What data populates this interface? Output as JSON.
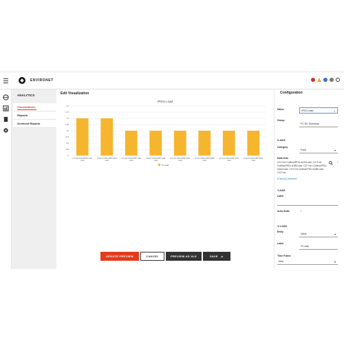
{
  "topbar": {
    "brand": "ENVIRONET"
  },
  "sidebar": {
    "title": "ANALYTICS",
    "items": [
      {
        "label": "Visualizations",
        "active": true
      },
      {
        "label": "Reports",
        "active": false
      },
      {
        "label": "Archived Reports",
        "active": false
      }
    ]
  },
  "main": {
    "title": "Edit Visualization",
    "actions": {
      "update": "UPDATE PREVIEW",
      "cancel": "CANCEL",
      "preview_xls": "PREVIEW AS XLS",
      "save": "SAVE"
    }
  },
  "chart_data": {
    "type": "bar",
    "title": "rPDU Load",
    "categories": [
      "CG Fort Collins/rPDU A1A/Load",
      "CG Fort Collins/rPDU A1B/Load",
      "CG Fort Collins/rPDU A2A/Load",
      "CG Fort Collins/rPDU A2B/Load",
      "CG Fort Collins/rPDU B1A/Load",
      "CG Fort Collins/rPDU B2B/Load",
      "CG Fort Collins/rPDU B2A/Load",
      "CG Fort Collins/rPDU B3A/Load"
    ],
    "series": [
      {
        "name": "% Load",
        "values": [
          1.5,
          1.5,
          1.0,
          1.0,
          1.0,
          1.0,
          1.0,
          1.0
        ]
      }
    ],
    "ylim": [
      0,
      2.0
    ],
    "yticks": [
      "2.0",
      "1.75",
      "1.5",
      "1.25",
      "1.0",
      "0.75",
      "0.5",
      "0.25",
      "0"
    ],
    "color": "#f5b52e",
    "grid": true,
    "legend": "bottom"
  },
  "config": {
    "title": "Configuration",
    "name_label": "Name",
    "name_value": "rPDU Load",
    "group_label": "Group",
    "group_value": "FC DC Summary",
    "xaxis_heading": "X-AXIS",
    "category_label": "Category",
    "category_value": "Point",
    "datasets_label": "Data Sets",
    "datasets_value": "CG Fort Collins/rPDU A1A/Load, CG Fort Collins/rPDU A1B/Load, CG Fort Collins/rPDU A2A/Load, CG Fort Collins/rPDU A2B/Load, CG Fort",
    "items_selected": "8 Item(s) Selected",
    "yaxis_heading": "Y-AXIS",
    "ylabel_label": "Label",
    "autoscale_label": "Auto Scale",
    "pct_heading": "% LOAD",
    "entry_label": "Entry",
    "entry_value": "Value",
    "label2_label": "Label",
    "label2_value": "% Load",
    "timeframe_label": "Time Frame",
    "timeframe_value": "Now"
  }
}
